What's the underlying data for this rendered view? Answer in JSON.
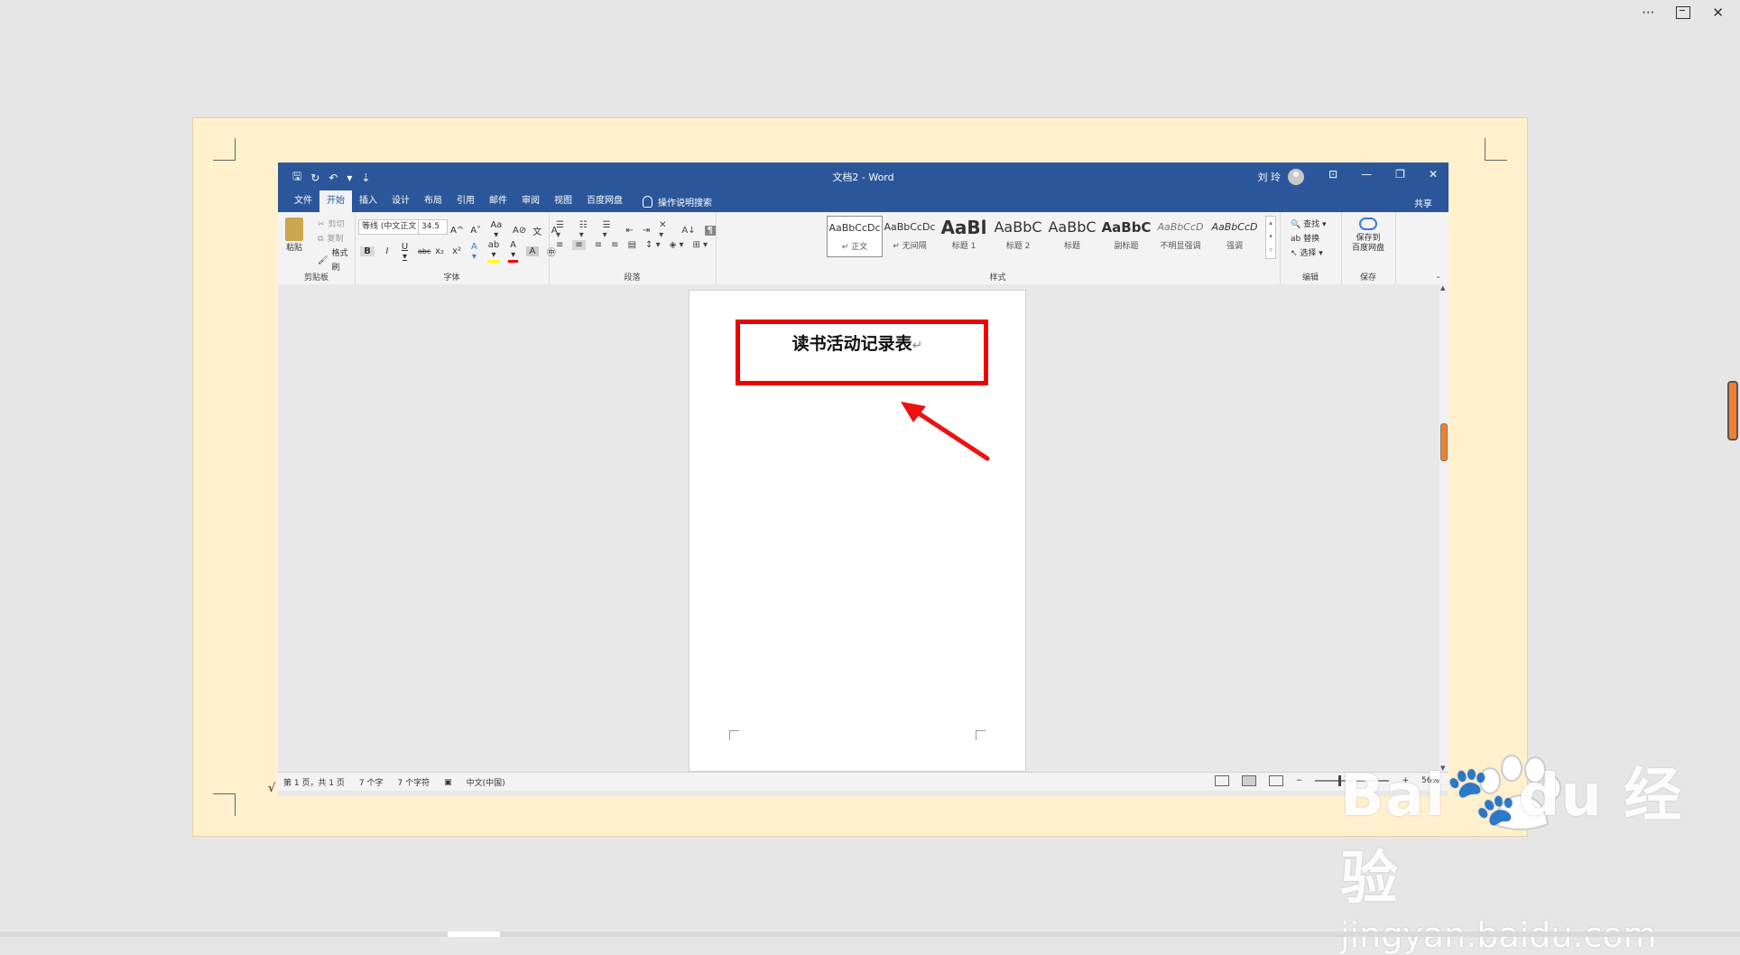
{
  "outer_controls": {
    "more": "···",
    "close": "✕"
  },
  "titlebar": {
    "qat": [
      "🖫",
      "↻",
      "↶",
      "▾",
      "⇣"
    ],
    "title": "文档2 - Word",
    "user": "刘 玲",
    "ribbon_display": "⊡",
    "minimize": "—",
    "restore": "❐",
    "close": "✕"
  },
  "tabs": [
    "文件",
    "开始",
    "插入",
    "设计",
    "布局",
    "引用",
    "邮件",
    "审阅",
    "视图",
    "百度网盘"
  ],
  "tell_me": "操作说明搜索",
  "share": "共享",
  "ribbon": {
    "clipboard": {
      "paste": "粘贴",
      "cut": "剪切",
      "copy": "复制",
      "format_painter": "格式刷",
      "label": "剪贴板"
    },
    "font": {
      "font_name": "等线 (中文正文",
      "font_size": "34.5",
      "label": "字体",
      "row1": [
        "A^",
        "A˅",
        "Aa ▾",
        "A⊘",
        "文",
        "A"
      ],
      "row2": [
        "B",
        "I",
        "U ▾",
        "abc",
        "x₂",
        "x²",
        "A ▾",
        "ab ▾",
        "A ▾",
        "A",
        "㊥"
      ]
    },
    "paragraph": {
      "label": "段落",
      "row1": [
        "☰ ▾",
        "☷ ▾",
        "☰ ▾",
        "⇤",
        "⇥",
        "✕ ▾",
        "A↓",
        "¶"
      ],
      "row2": [
        "≡",
        "≡",
        "≡",
        "≡",
        "▤",
        "↕ ▾",
        "◈ ▾",
        "⊞ ▾"
      ]
    },
    "styles": {
      "label": "样式",
      "items": [
        {
          "sample": "AaBbCcDc",
          "name": "↵ 正文"
        },
        {
          "sample": "AaBbCcDc",
          "name": "↵ 无间隔"
        },
        {
          "sample": "AaBl",
          "name": "标题 1"
        },
        {
          "sample": "AaBbC",
          "name": "标题 2"
        },
        {
          "sample": "AaBbC",
          "name": "标题"
        },
        {
          "sample": "AaBbC",
          "name": "副标题"
        },
        {
          "sample": "AaBbCcD",
          "name": "不明显强调"
        },
        {
          "sample": "AaBbCcD",
          "name": "强调"
        }
      ]
    },
    "editing": {
      "find": "查找 ▾",
      "replace": "替换",
      "select": "选择 ▾",
      "label": "编辑"
    },
    "save": {
      "line1": "保存到",
      "line2": "百度网盘",
      "label": "保存"
    }
  },
  "document": {
    "heading": "读书活动记录表",
    "para_mark": "↵"
  },
  "status": {
    "page": "第 1 页，共 1 页",
    "words": "7 个字",
    "chars": "7 个字符",
    "language": "中文(中国)",
    "zoom_minus": "−",
    "zoom_plus": "+",
    "zoom": "56%"
  },
  "overlay": {
    "check_mark": "√"
  },
  "watermark": {
    "brand": "Bai🐾du 经验",
    "url": "jingyan.baidu.com"
  },
  "colors": {
    "word_blue": "#2b579a",
    "annotation_red": "#ee0000",
    "frame_bg": "#fff1cd"
  }
}
